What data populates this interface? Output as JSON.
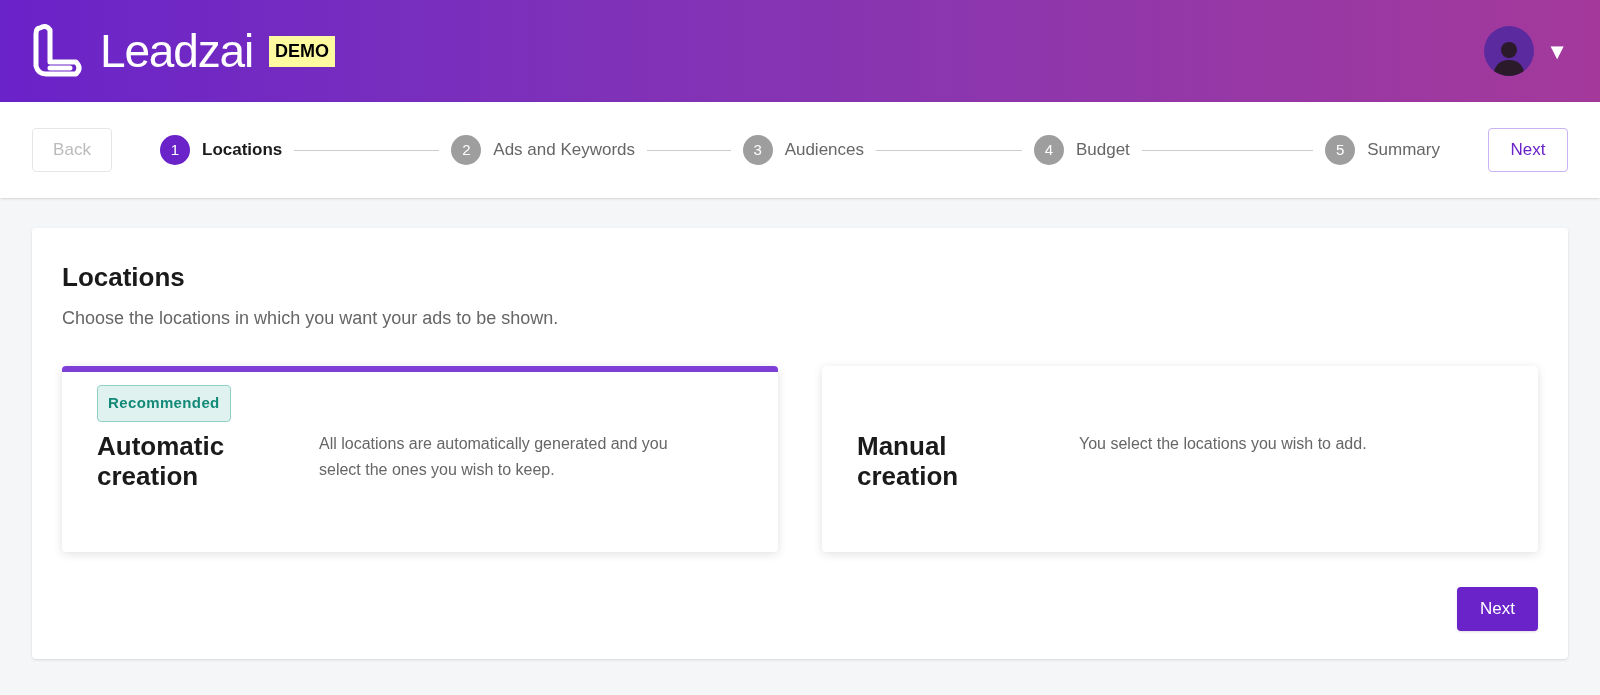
{
  "header": {
    "brand": "Leadzai",
    "badge": "DEMO",
    "menu_caret": "▼"
  },
  "stepper": {
    "back": {
      "label": "Back",
      "disabled": true
    },
    "next": {
      "label": "Next"
    },
    "steps": [
      {
        "number": "1",
        "label": "Locations",
        "selected": true
      },
      {
        "number": "2",
        "label": "Ads and Keywords",
        "selected": false
      },
      {
        "number": "3",
        "label": "Audiences",
        "selected": false
      },
      {
        "number": "4",
        "label": "Budget",
        "selected": false
      },
      {
        "number": "5",
        "label": "Summary",
        "selected": false
      }
    ]
  },
  "content": {
    "title": "Locations",
    "subtitle": "Choose the locations in which you want your ads to be shown.",
    "options": [
      {
        "badge": "Recommended",
        "title": "Automatic creation",
        "description": "All locations are automatically generated and you select the ones you wish to keep.",
        "selected": true
      },
      {
        "title": "Manual creation",
        "description": "You select the locations you wish to add.",
        "selected": false
      }
    ],
    "next": "Next"
  }
}
